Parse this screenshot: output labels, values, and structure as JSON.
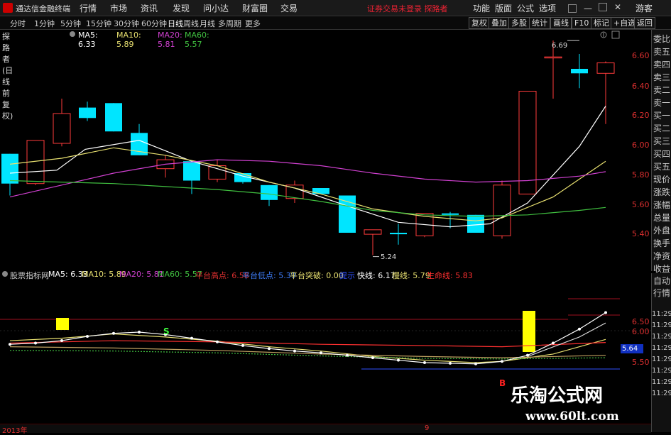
{
  "menubar": {
    "app_title": "通达信金融终端",
    "menus": [
      "行情",
      "市场",
      "资讯",
      "发现",
      "问小达",
      "财富圈",
      "交易"
    ],
    "notice": "证券交易未登录  探路者",
    "right_menus": [
      "功能",
      "版面",
      "公式",
      "选项"
    ],
    "guest": "游客"
  },
  "periods": {
    "items": [
      "分时",
      "1分钟",
      "5分钟",
      "15分钟",
      "30分钟",
      "60分钟",
      "日线",
      "周线",
      "月线",
      "多周期",
      "更多"
    ],
    "active": "日线"
  },
  "toolbar": {
    "buttons": [
      "复权",
      "叠加",
      "多股",
      "统计",
      "画线",
      "F10",
      "标记",
      "+自选",
      "返回"
    ]
  },
  "main_header": {
    "stock": "探路者(日线 前复权)",
    "ma5": "MA5: 6.33",
    "ma10": "MA10: 5.89",
    "ma20": "MA20: 5.81",
    "ma60": "MA60: 5.57"
  },
  "sub_header": {
    "name": "股票指标网",
    "ma5": "MA5: 6.33",
    "ma10": "MA10: 5.89",
    "ma20": "MA20: 5.81",
    "ma60": "MA60: 5.57",
    "pingtai_gao": "平台高点: 6.58",
    "pingtai_di": "平台低点: 5.39",
    "pingtai_tupo": "平台突破: 0.00",
    "extra": "提示",
    "kuaixian": "快线: 6.17",
    "manxian": "慢线: 5.79",
    "shengming": "生命线: 5.83"
  },
  "main_axis": [
    "6.60",
    "6.40",
    "6.20",
    "6.00",
    "5.80",
    "5.60",
    "5.40"
  ],
  "sub_axis": [
    "6.50",
    "6.00",
    "5.50"
  ],
  "sub_time_axis": [
    "11:29",
    "11:29",
    "11:29",
    "11:29",
    "11:29",
    "11:29",
    "11:29",
    "11:29"
  ],
  "price_flag": "5.64",
  "annotations": {
    "high": "6.69",
    "low": "5.24",
    "s_mark": "S",
    "b_mark": "B"
  },
  "right_panel": [
    "委比",
    "卖五",
    "卖四",
    "卖三",
    "卖二",
    "卖一",
    "买一",
    "买二",
    "买三",
    "买四",
    "买五",
    "现价",
    "涨跌",
    "涨幅",
    "总量",
    "外盘",
    "换手",
    "净资",
    "收益"
  ],
  "right_panel2": [
    "自动",
    "行情"
  ],
  "bottom": {
    "year": "2013年",
    "mark": "9"
  },
  "watermark": {
    "line1": "乐淘公式网",
    "line2": "www.60lt.com"
  },
  "colors": {
    "up": "#ff3b3b",
    "down": "#00e5ff",
    "ma5": "#ffffff",
    "ma10": "#e8e070",
    "ma20": "#d040d0",
    "ma60": "#40c040",
    "accent": "#d00000"
  }
}
